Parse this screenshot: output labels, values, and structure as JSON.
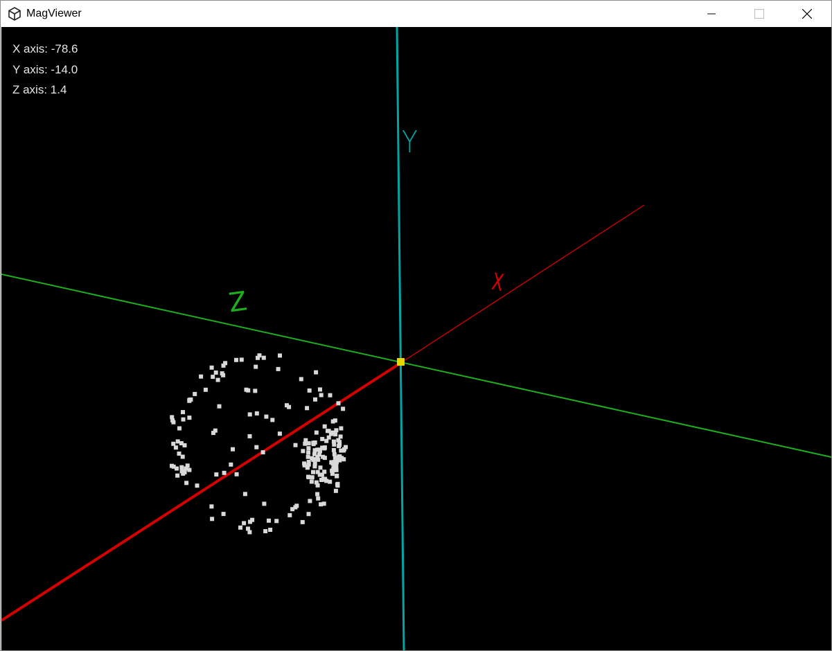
{
  "window": {
    "title": "MagViewer",
    "icon": "unity-logo-icon",
    "controls": [
      "minimize-icon",
      "maximize-icon",
      "close-icon"
    ]
  },
  "readouts": {
    "x": "X axis: -78.6",
    "y": "Y axis: -14.0",
    "z": "Z axis: 1.4"
  },
  "axes": {
    "x": {
      "label": "X",
      "color": "#d40000"
    },
    "y": {
      "label": "Y",
      "color": "#00a6a6"
    },
    "z": {
      "label": "Z",
      "color": "#1fae1f"
    }
  },
  "origin_marker_color": "#e8d800",
  "point_color": "#d9d9d9",
  "background_color": "#000000"
}
